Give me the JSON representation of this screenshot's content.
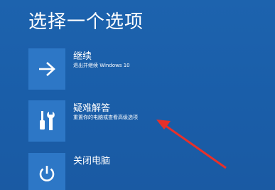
{
  "title": "选择一个选项",
  "options": [
    {
      "label": "继续",
      "description": "退出并继续 Windows 10",
      "icon": "arrow-right-icon"
    },
    {
      "label": "疑难解答",
      "description": "重置你的电脑或查看高级选项",
      "icon": "tools-icon"
    },
    {
      "label": "关闭电脑",
      "description": "",
      "icon": "power-icon"
    }
  ],
  "colors": {
    "background": "#1a5ea9",
    "tile": "#2d77c6",
    "text": "#ffffff",
    "annotation_arrow": "#e8302a"
  }
}
